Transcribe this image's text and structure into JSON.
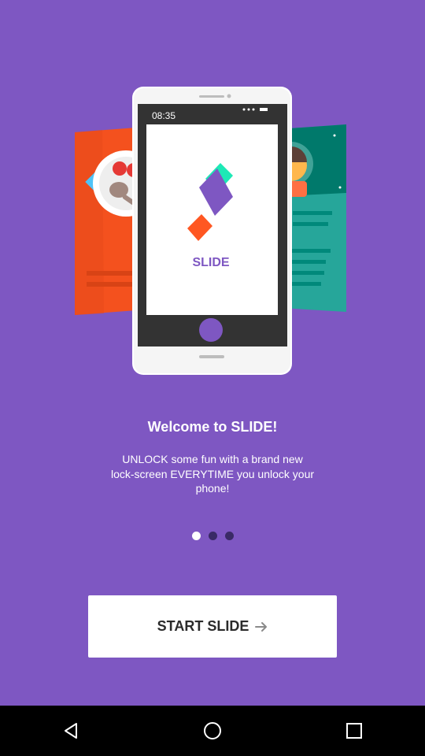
{
  "phone": {
    "time": "08:35",
    "app_name": "SLIDE"
  },
  "welcome": {
    "title": "Welcome to SLIDE!",
    "description": "UNLOCK some fun with a brand new lock-screen EVERYTIME you unlock your phone!"
  },
  "pager": {
    "count": 3,
    "active_index": 0
  },
  "start_button": {
    "label": "START SLIDE",
    "icon": "arrow-right-icon"
  },
  "nav": {
    "back_icon": "back-icon",
    "home_icon": "home-icon",
    "recents_icon": "recents-icon"
  },
  "colors": {
    "background": "#7e57c2",
    "orange_card": "#f4511e",
    "teal_card": "#26a69a",
    "logo_teal": "#1de9b6",
    "logo_purple": "#7e57c2",
    "logo_orange": "#ff5722"
  }
}
